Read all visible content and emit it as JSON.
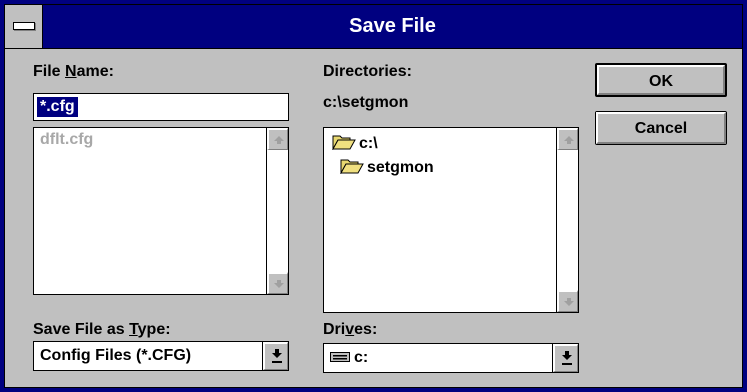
{
  "window": {
    "title": "Save File"
  },
  "file_name": {
    "label_pre": "File ",
    "label_key": "N",
    "label_post": "ame:",
    "value": "*.cfg",
    "files": [
      "dflt.cfg"
    ]
  },
  "directories": {
    "label": "Directories:",
    "current_path": "c:\\setgmon",
    "items": [
      "c:\\",
      "setgmon"
    ]
  },
  "file_type": {
    "label_pre": "Save File as ",
    "label_key": "T",
    "label_post": "ype:",
    "selected": "Config Files (*.CFG)"
  },
  "drives": {
    "label_pre": "Dri",
    "label_key": "v",
    "label_post": "es:",
    "selected": "c:"
  },
  "buttons": {
    "ok": "OK",
    "cancel": "Cancel"
  },
  "icons": {
    "scroll_up": "up-arrow-icon",
    "scroll_down": "down-arrow-icon",
    "dropdown": "down-arrow-underline-icon",
    "folder_open": "open-folder-icon",
    "folder": "folder-icon",
    "drive": "drive-icon"
  },
  "colors": {
    "titlebar": "#000080",
    "face": "#c0c0c0",
    "selection": "#000080"
  }
}
